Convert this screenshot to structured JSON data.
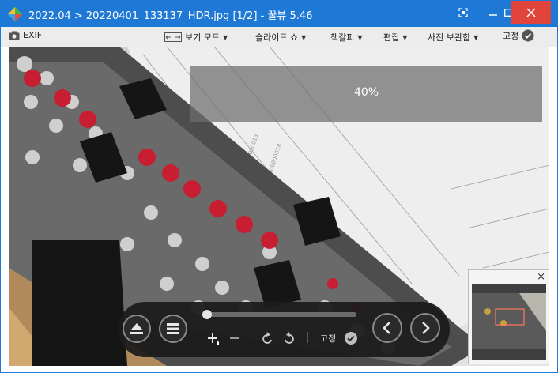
{
  "titlebar": {
    "title": "2022.04 > 20220401_133137_HDR.jpg [1/2] - 꿀뷰 5.46",
    "bg_color": "#1e78d6",
    "close_color": "#e0443b"
  },
  "menubar": {
    "exif": "EXIF",
    "view_mode": "보기 모드",
    "slideshow": "슬라이드 쇼",
    "bookmark": "책갈피",
    "edit": "편집",
    "photo_album": "사진 보관함",
    "pin": "고정"
  },
  "viewer": {
    "zoom_overlay": "40%"
  },
  "controls": {
    "pin_label": "고정",
    "icons": [
      "eject-icon",
      "menu-icon",
      "zoom-in-icon",
      "zoom-out-icon",
      "rotate-left-icon",
      "rotate-right-icon",
      "check-icon",
      "prev-icon",
      "next-icon"
    ]
  }
}
